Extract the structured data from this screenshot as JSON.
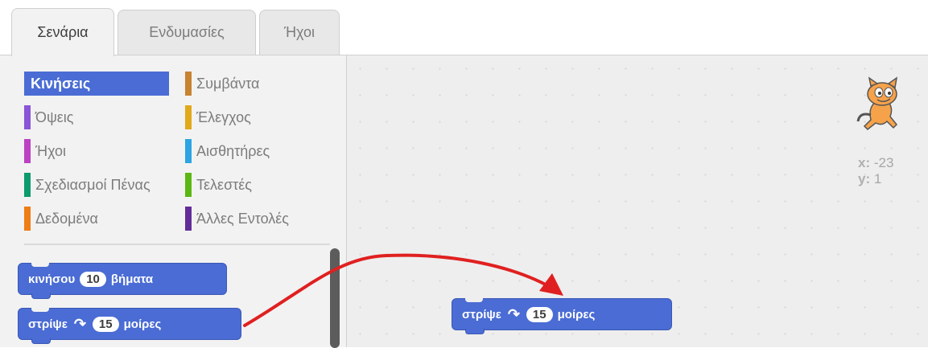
{
  "tabs": [
    {
      "label": "Σενάρια"
    },
    {
      "label": "Ενδυμασίες"
    },
    {
      "label": "Ήχοι"
    }
  ],
  "categories": [
    {
      "label": "Κινήσεις",
      "color": "#4a6cd4"
    },
    {
      "label": "Συμβάντα",
      "color": "#c88330"
    },
    {
      "label": "Όψεις",
      "color": "#8a55d7"
    },
    {
      "label": "Έλεγχος",
      "color": "#e1a91a"
    },
    {
      "label": "Ήχοι",
      "color": "#bb42c3"
    },
    {
      "label": "Αισθητήρες",
      "color": "#2ca5e2"
    },
    {
      "label": "Σχεδιασμοί Πένας",
      "color": "#0e9a6c"
    },
    {
      "label": "Τελεστές",
      "color": "#5cb712"
    },
    {
      "label": "Δεδομένα",
      "color": "#ee7d16"
    },
    {
      "label": "Άλλες Εντολές",
      "color": "#632d99"
    }
  ],
  "blocks": {
    "move": {
      "prefix": "κινήσου",
      "value": "10",
      "suffix": "βήματα"
    },
    "turn": {
      "prefix": "στρίψε",
      "value": "15",
      "suffix": "μοίρες"
    }
  },
  "script_block": {
    "prefix": "στρίψε",
    "value": "15",
    "suffix": "μοίρες"
  },
  "sprite": {
    "x_label": "x:",
    "x_value": "-23",
    "y_label": "y:",
    "y_value": "1"
  },
  "icons": {
    "rotate": "rotate-clockwise-icon",
    "sprite": "cat-sprite-icon",
    "arrow": "drag-arrow-icon"
  },
  "colors": {
    "motion": "#4a6cd4",
    "arrow": "#e02020"
  }
}
